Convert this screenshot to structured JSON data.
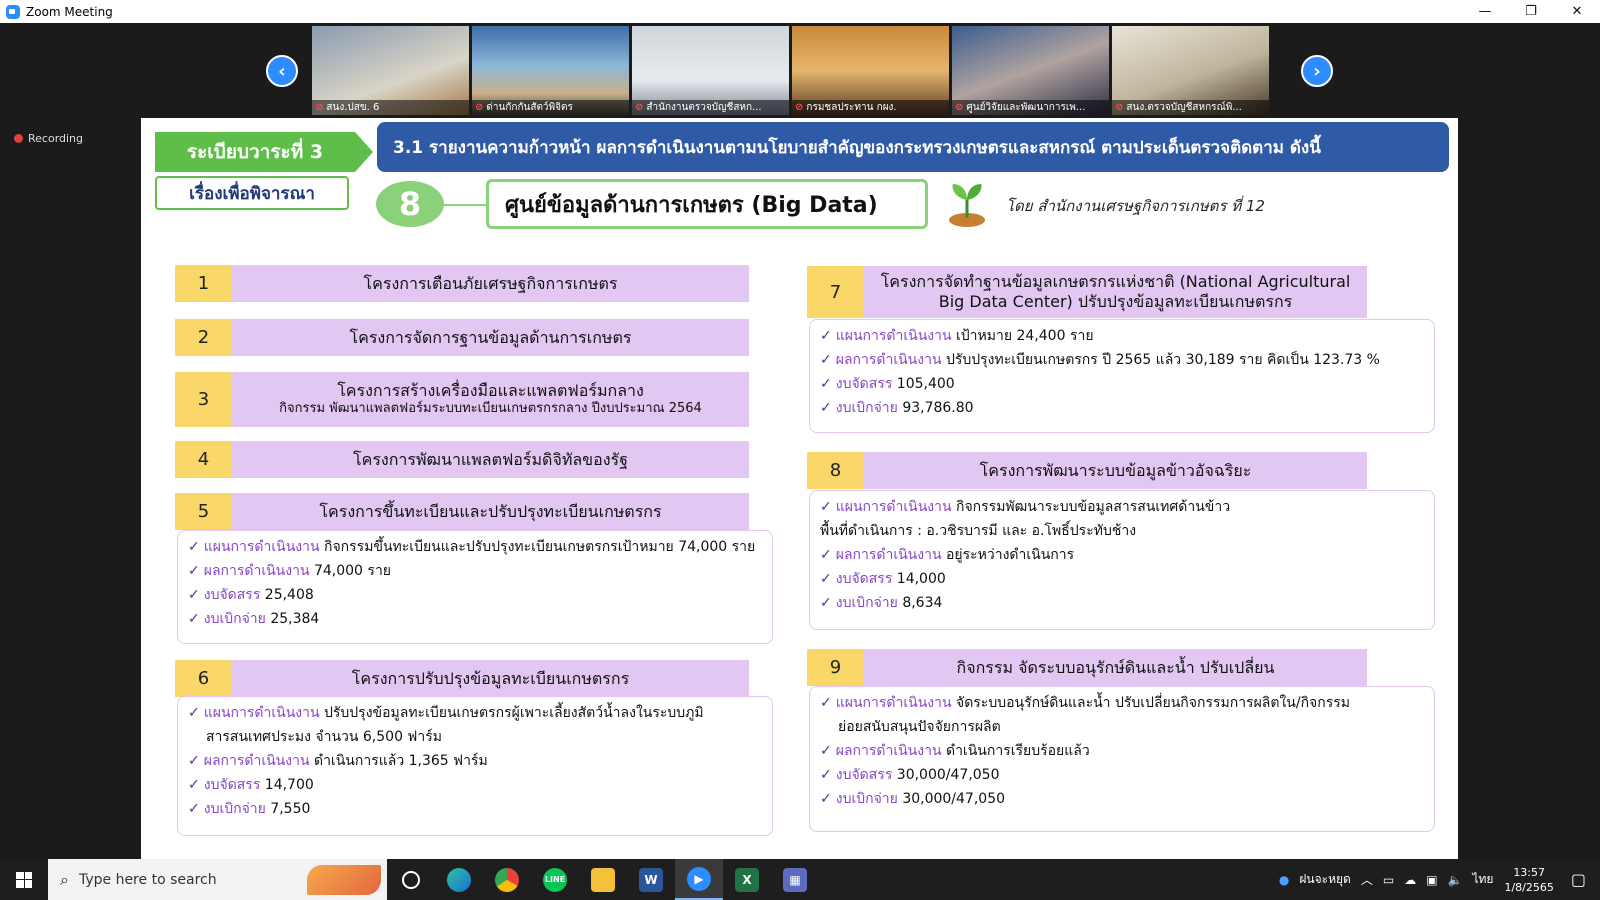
{
  "window": {
    "title": "Zoom Meeting",
    "controls": [
      "—",
      "❐",
      "✕"
    ]
  },
  "recording": {
    "label": "Recording"
  },
  "gallery": {
    "prev": "‹",
    "next": "›",
    "participants": [
      {
        "name": "สนง.ปสข. 6"
      },
      {
        "name": "ด่านกักกันสัตว์พิจิตร"
      },
      {
        "name": "สำนักงานตรวจบัญชีสหก..."
      },
      {
        "name": "กรมชลประทาน กผง."
      },
      {
        "name": "ศูนย์วิจัยและพัฒนาการเพ..."
      },
      {
        "name": "สนง.ตรวจบัญชีสหกรณ์พิ..."
      }
    ]
  },
  "slide": {
    "agenda": "ระเบียบวาระที่ 3",
    "consider": "เรื่องเพื่อพิจารณา",
    "headline": "3.1 รายงานความก้าวหน้า ผลการดำเนินงานตามนโยบายสำคัญของกระทรวงเกษตรและสหกรณ์ ตามประเด็นตรวจติดตาม ดังนี้",
    "item_number": "8",
    "item_title": "ศูนย์ข้อมูลด้านการเกษตร (Big Data)",
    "byline": "โดย สำนักงานเศรษฐกิจการเกษตร ที่ 12",
    "projects": [
      {
        "num": "1",
        "title": "โครงการเตือนภัยเศรษฐกิจการเกษตร"
      },
      {
        "num": "2",
        "title": "โครงการจัดการฐานข้อมูลด้านการเกษตร"
      },
      {
        "num": "3",
        "title": "โครงการสร้างเครื่องมือและแพลตฟอร์มกลาง",
        "sub": "กิจกรรม พัฒนาแพลตฟอร์มระบบทะเบียนเกษตรกรกลาง ปีงบประมาณ 2564"
      },
      {
        "num": "4",
        "title": "โครงการพัฒนาแพลตฟอร์มดิจิทัลของรัฐ"
      },
      {
        "num": "5",
        "title": "โครงการขึ้นทะเบียนและปรับปรุงทะเบียนเกษตรกร"
      },
      {
        "num": "6",
        "title": "โครงการปรับปรุงข้อมูลทะเบียนเกษตรกร"
      },
      {
        "num": "7",
        "title": "โครงการจัดทำฐานข้อมูลเกษตรกรแห่งชาติ (National Agricultural",
        "title2": "Big Data Center) ปรับปรุงข้อมูลทะเบียนเกษตรกร"
      },
      {
        "num": "8",
        "title": "โครงการพัฒนาระบบข้อมูลข้าวอัจฉริยะ"
      },
      {
        "num": "9",
        "title": "กิจกรรม จัดระบบอนุรักษ์ดินและน้ำ ปรับเปลี่ยน"
      }
    ],
    "details": {
      "p5": [
        {
          "k": "แผนการดำเนินงาน",
          "v": " กิจกรรมขึ้นทะเบียนและปรับปรุงทะเบียนเกษตรกรเป้าหมาย 74,000 ราย"
        },
        {
          "k": "ผลการดำเนินงาน",
          "v": " 74,000 ราย"
        },
        {
          "k": "งบจัดสรร",
          "v": " 25,408"
        },
        {
          "k": "งบเบิกจ่าย",
          "v": " 25,384"
        }
      ],
      "p6": [
        {
          "k": "แผนการดำเนินงาน",
          "v": " ปรับปรุงข้อมูลทะเบียนเกษตรกรผู้เพาะเลี้ยงสัตว์น้ำลงในระบบภูมิ"
        },
        {
          "cont": "สารสนเทศประมง จำนวน 6,500 ฟาร์ม"
        },
        {
          "k": "ผลการดำเนินงาน",
          "v": " ดำเนินการแล้ว 1,365 ฟาร์ม"
        },
        {
          "k": "งบจัดสรร",
          "v": " 14,700"
        },
        {
          "k": "งบเบิกจ่าย",
          "v": " 7,550"
        }
      ],
      "p7": [
        {
          "k": "แผนการดำเนินงาน",
          "v": " เป้าหมาย 24,400 ราย"
        },
        {
          "k": "ผลการดำเนินงาน",
          "v": " ปรับปรุงทะเบียนเกษตรกร ปี 2565 แล้ว 30,189 ราย คิดเป็น 123.73 %"
        },
        {
          "k": "งบจัดสรร",
          "v": " 105,400"
        },
        {
          "k": "งบเบิกจ่าย",
          "v": " 93,786.80"
        }
      ],
      "p8": [
        {
          "k": "แผนการดำเนินงาน",
          "v": " กิจกรรมพัฒนาระบบข้อมูลสารสนเทศด้านข้าว"
        },
        {
          "cont": "พื้นที่ดำเนินการ : อ.วชิรบารมี และ อ.โพธิ์ประทับช้าง"
        },
        {
          "k": "ผลการดำเนินงาน",
          "v": " อยู่ระหว่างดำเนินการ"
        },
        {
          "k": "งบจัดสรร",
          "v": " 14,000"
        },
        {
          "k": "งบเบิกจ่าย",
          "v": " 8,634"
        }
      ],
      "p9": [
        {
          "k": "แผนการดำเนินงาน",
          "v": " จัดระบบอนุรักษ์ดินและน้ำ ปรับเปลี่ยนกิจกรรมการผลิตใน/กิจกรรม"
        },
        {
          "cont": "ย่อยสนับสนุนปัจจัยการผลิต"
        },
        {
          "k": "ผลการดำเนินงาน",
          "v": " ดำเนินการเรียบร้อยแล้ว"
        },
        {
          "k": "งบจัดสรร",
          "v": " 30,000/47,050"
        },
        {
          "k": "งบเบิกจ่าย",
          "v": " 30,000/47,050"
        }
      ]
    }
  },
  "taskbar": {
    "search_placeholder": "Type here to search",
    "weather": "ฝนจะหยุด",
    "lang": "ไทย",
    "time": "13:57",
    "date": "1/8/2565"
  }
}
